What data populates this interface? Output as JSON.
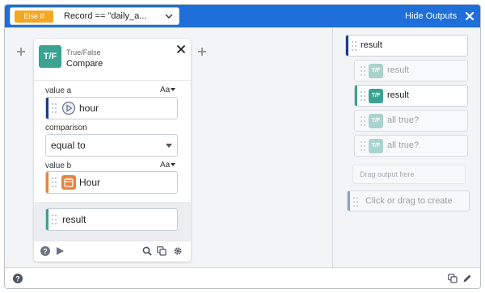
{
  "topbar": {
    "condition_badge": "Else If",
    "condition_text": "Record  ==  \"daily_a...",
    "hide_outputs_label": "Hide Outputs",
    "accent_color": "#1e6fd9"
  },
  "card": {
    "badge": "T/F",
    "kind": "True/False",
    "title": "Compare",
    "value_a": {
      "label": "value a",
      "type_toggle": "Aa",
      "value": "hour",
      "icon": "play-circle-icon"
    },
    "comparison": {
      "label": "comparison",
      "selected": "equal to"
    },
    "value_b": {
      "label": "value b",
      "type_toggle": "Aa",
      "value": "Hour",
      "icon": "calendar-icon"
    },
    "result": {
      "value": "result"
    }
  },
  "outputs": {
    "items": [
      {
        "label": "result",
        "badge": ""
      },
      {
        "label": "result",
        "badge": "T/F"
      },
      {
        "label": "result",
        "badge": "T/F"
      },
      {
        "label": "all true?",
        "badge": "T/F"
      },
      {
        "label": "all true?",
        "badge": "T/F"
      }
    ],
    "drag_placeholder": "Drag output here",
    "create_placeholder": "Click or drag to create"
  },
  "colors": {
    "badge_teal": "#3aa392",
    "badge_teal_faded": "#a9d4cd",
    "value_a_bar": "#1a3a8a",
    "value_b_bar": "#e8843e",
    "result_bar": "#3aa392",
    "else_if": "#f5a623"
  }
}
